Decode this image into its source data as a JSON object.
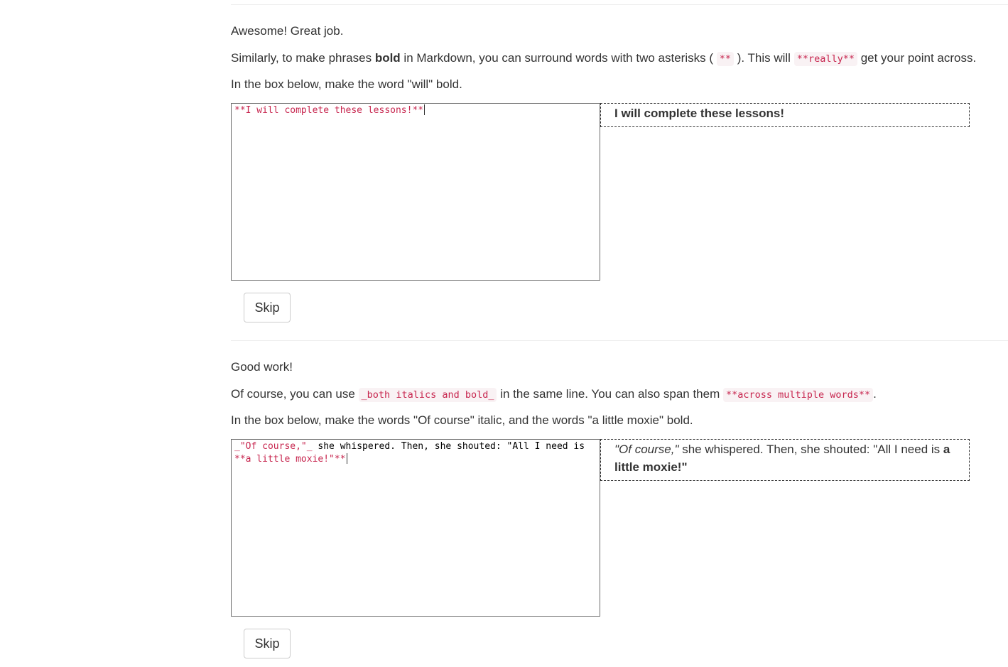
{
  "lesson_bold": {
    "praise": "Awesome! Great job.",
    "instruction_a": "Similarly, to make phrases ",
    "instruction_bold_word": "bold",
    "instruction_b": " in Markdown, you can surround words with two asterisks ( ",
    "instruction_code_1": "**",
    "instruction_c": " ). This will ",
    "instruction_code_2": "**really**",
    "instruction_d": " get your point across.",
    "task": "In the box below, make the word \"will\" bold.",
    "editor": {
      "md_text": "**I will complete these lessons!**"
    },
    "preview": {
      "bold_text": "I will complete these lessons!"
    },
    "skip_label": "Skip"
  },
  "lesson_both": {
    "praise": "Good work!",
    "instruction_a": "Of course, you can use ",
    "instruction_code_1": "_both italics and bold_",
    "instruction_b": " in the same line. You can also span them ",
    "instruction_code_2": "**across multiple words**",
    "instruction_c": ".",
    "task": "In the box below, make the words \"Of course\" italic, and the words \"a little moxie\" bold.",
    "editor": {
      "md_italic": "_\"Of course,\"_",
      "plain": " she whispered. Then, she shouted: \"All I need is ",
      "md_bold": "**a little moxie!\"**"
    },
    "preview": {
      "italic_text": "\"Of course,\"",
      "plain_text": " she whispered. Then, she shouted: \"All I need is ",
      "bold_text": "a little moxie!\""
    },
    "skip_label": "Skip"
  },
  "colors": {
    "code_text": "#c7254e",
    "code_bg": "#f9f2f4",
    "body_text": "#333333"
  }
}
